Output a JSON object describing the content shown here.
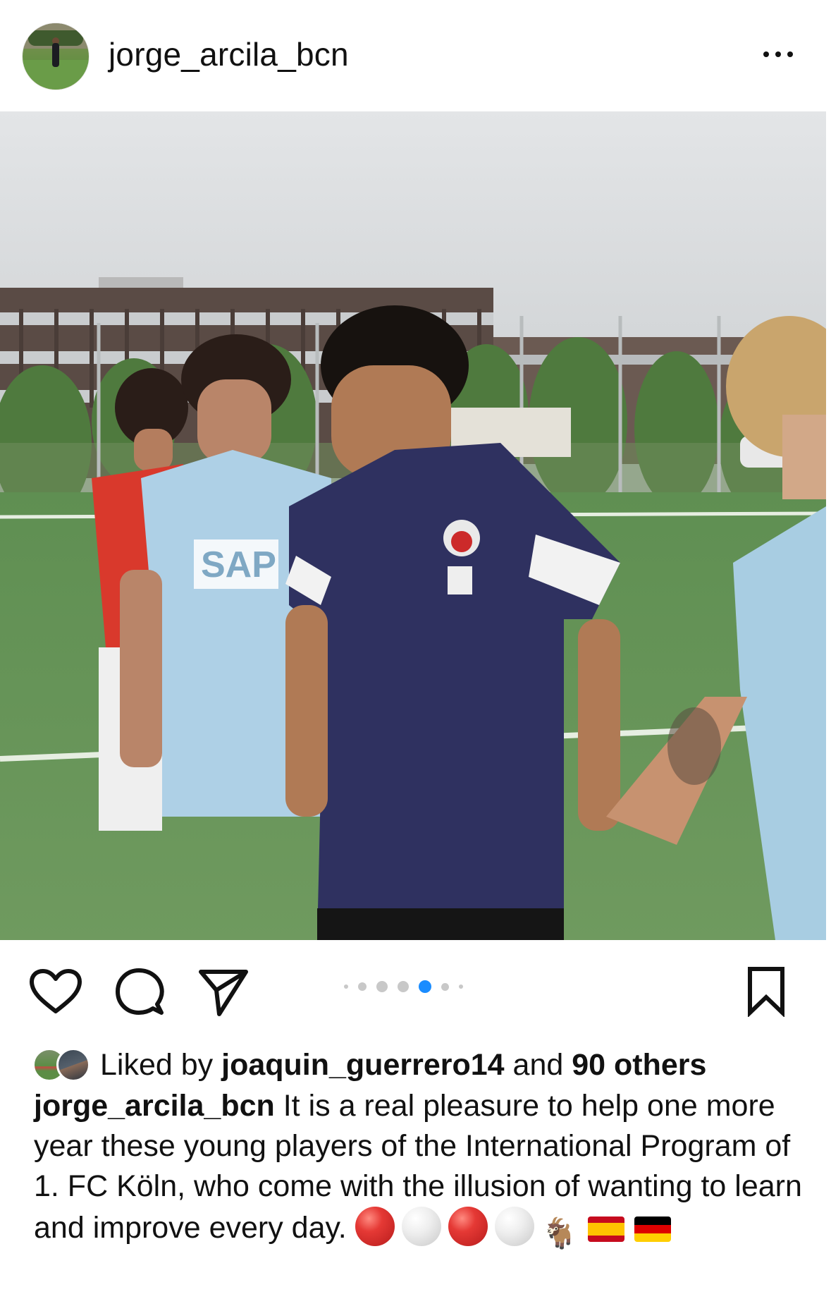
{
  "post": {
    "username": "jorge_arcila_bcn",
    "more_icon": "more-horizontal-icon"
  },
  "photo": {
    "shirt_sponsor": "SAP",
    "carousel_count": 7,
    "carousel_active_index": 4
  },
  "actions": {
    "like_icon": "heart-outline-icon",
    "comment_icon": "comment-bubble-icon",
    "share_icon": "send-paper-plane-icon",
    "save_icon": "bookmark-outline-icon"
  },
  "likes": {
    "prefix": "Liked by",
    "user": "joaquin_guerrero14",
    "joiner": "and",
    "others": "90 others"
  },
  "caption": {
    "author": "jorge_arcila_bcn",
    "text": "It is a real pleasure to help one more year these young players of the International Program of 1. FC Köln, who come with the illusion of wanting to learn and improve every day.",
    "emojis": [
      "red-circle",
      "white-circle",
      "red-circle",
      "white-circle",
      "goat",
      "flag-spain",
      "flag-germany"
    ]
  },
  "colors": {
    "active_dot": "#1a8cff",
    "inactive_dot": "#c8c8c8"
  }
}
